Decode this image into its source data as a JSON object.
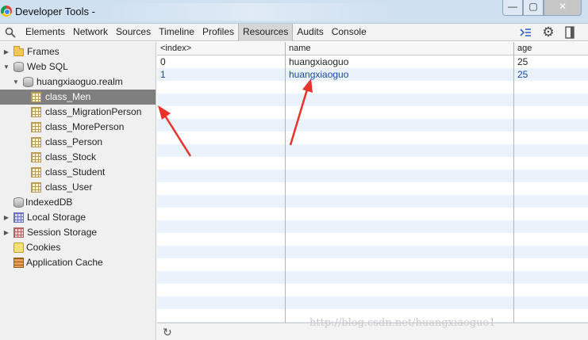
{
  "window": {
    "title": "Developer Tools -",
    "minimize": "—",
    "maximize": "▢",
    "close": "✕"
  },
  "toolbar": {
    "tabs": [
      "Elements",
      "Network",
      "Sources",
      "Timeline",
      "Profiles",
      "Resources",
      "Audits",
      "Console"
    ],
    "active_tab": "Resources",
    "right_icons": [
      "show-drawer-icon",
      "gear-icon",
      "dock-icon"
    ]
  },
  "sidebar": {
    "items": [
      {
        "label": "Frames",
        "icon": "folder-icon"
      },
      {
        "label": "Web SQL",
        "icon": "database-icon"
      },
      {
        "label": "huangxiaoguo.realm",
        "icon": "database-icon"
      },
      {
        "label": "class_Men",
        "icon": "table-icon",
        "selected": true
      },
      {
        "label": "class_MigrationPerson",
        "icon": "table-icon"
      },
      {
        "label": "class_MorePerson",
        "icon": "table-icon"
      },
      {
        "label": "class_Person",
        "icon": "table-icon"
      },
      {
        "label": "class_Stock",
        "icon": "table-icon"
      },
      {
        "label": "class_Student",
        "icon": "table-icon"
      },
      {
        "label": "class_User",
        "icon": "table-icon"
      },
      {
        "label": "IndexedDB",
        "icon": "database-icon"
      },
      {
        "label": "Local Storage",
        "icon": "local-storage-icon"
      },
      {
        "label": "Session Storage",
        "icon": "session-storage-icon"
      },
      {
        "label": "Cookies",
        "icon": "cookie-icon"
      },
      {
        "label": "Application Cache",
        "icon": "app-cache-icon"
      }
    ]
  },
  "table": {
    "columns": [
      "<index>",
      "name",
      "age"
    ],
    "rows": [
      {
        "index": "0",
        "name": "huangxiaoguo",
        "age": "25"
      },
      {
        "index": "1",
        "name": "huangxiaoguo",
        "age": "25"
      }
    ]
  },
  "statusbar": {
    "refresh_icon": "refresh-icon"
  },
  "watermark": "http://blog.csdn.net/huangxiaoguo1",
  "colors": {
    "selection": "#7f7f7f",
    "alt_row": "#eaf2fc",
    "arrow": "#e8322c",
    "titlebar": "#cfe0f1"
  }
}
